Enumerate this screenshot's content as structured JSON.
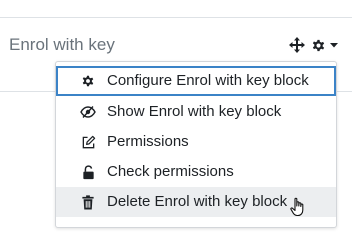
{
  "block": {
    "title": "Enrol with key"
  },
  "controls": {
    "move_icon": "move-arrows-icon",
    "actions_icon": "gear-icon",
    "dropdown_icon": "caret-down-icon"
  },
  "menu": {
    "items": [
      {
        "label": "Configure Enrol with key block",
        "icon": "gear-icon",
        "focused": true
      },
      {
        "label": "Show Enrol with key block",
        "icon": "eye-slash-icon"
      },
      {
        "label": "Permissions",
        "icon": "edit-icon"
      },
      {
        "label": "Check permissions",
        "icon": "unlock-icon"
      },
      {
        "label": "Delete Enrol with key block",
        "icon": "trash-icon",
        "hovered": true
      }
    ]
  },
  "colors": {
    "focus_border": "#3b83c7",
    "hover_bg": "#eceef0",
    "text": "#1d2125",
    "title_text": "#6a737b"
  }
}
